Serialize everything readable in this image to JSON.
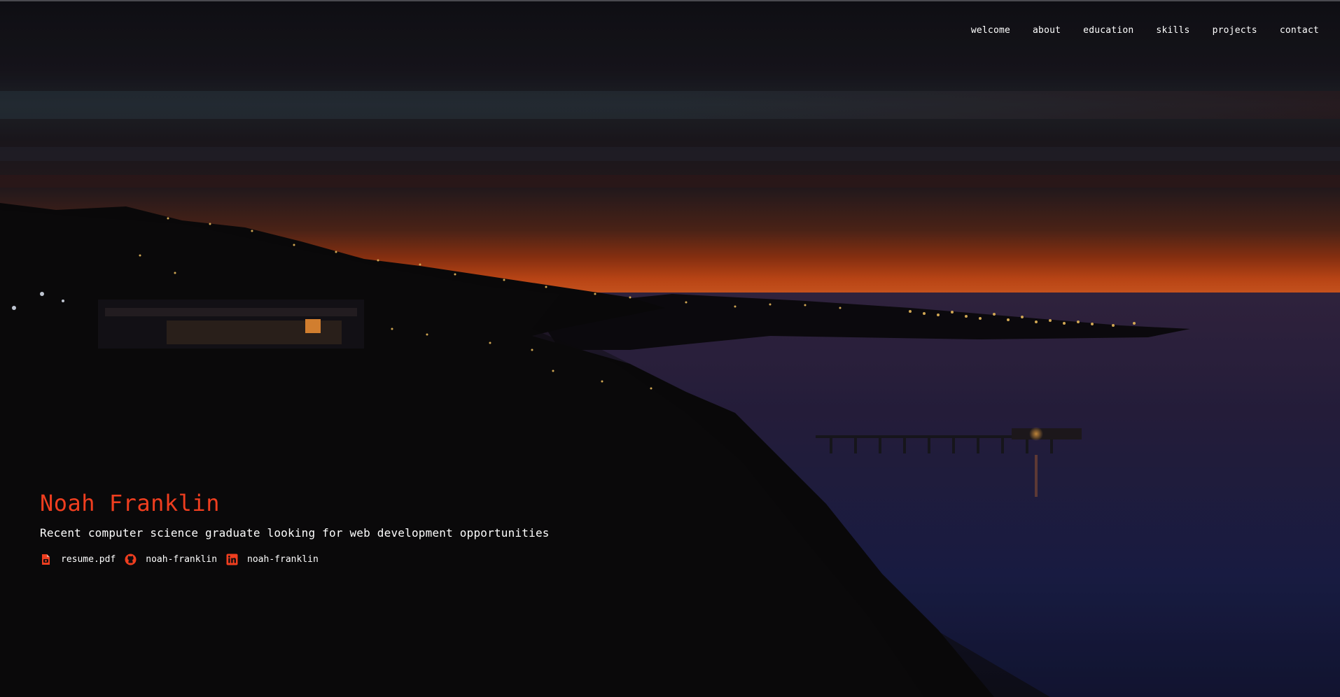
{
  "nav": {
    "items": [
      {
        "label": "welcome"
      },
      {
        "label": "about"
      },
      {
        "label": "education"
      },
      {
        "label": "skills"
      },
      {
        "label": "projects"
      },
      {
        "label": "contact"
      }
    ]
  },
  "hero": {
    "name": "Noah Franklin",
    "tagline": "Recent computer science graduate looking for web development opportunities",
    "links": [
      {
        "icon": "file-pdf-icon",
        "label": "resume.pdf"
      },
      {
        "icon": "github-icon",
        "label": "noah-franklin"
      },
      {
        "icon": "linkedin-icon",
        "label": "noah-franklin"
      }
    ]
  },
  "colors": {
    "accent": "#ef3e1f",
    "text": "#ffffff",
    "background": "#0d0d10"
  }
}
